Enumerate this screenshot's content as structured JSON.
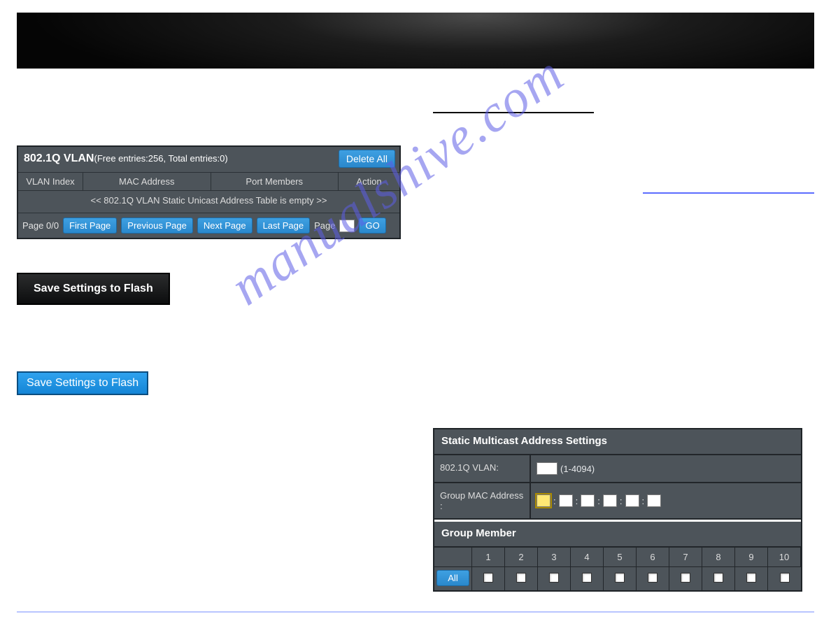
{
  "watermark": "manualshive.com",
  "left": {
    "vlan": {
      "title_bold": "802.1Q VLAN",
      "title_tail": "(Free entries:256, Total entries:0)",
      "delete_all": "Delete All",
      "col_index": "VLAN Index",
      "col_mac": "MAC Address",
      "col_members": "Port Members",
      "col_action": "Action",
      "empty_msg": "<< 802.1Q VLAN Static Unicast Address Table is empty >>",
      "page_of": "Page 0/0",
      "first": "First Page",
      "prev": "Previous Page",
      "next": "Next Page",
      "last": "Last Page",
      "page_label": "Page",
      "go": "GO"
    },
    "save_black": "Save Settings to Flash",
    "save_blue": "Save Settings to Flash"
  },
  "right": {
    "mcast": {
      "settings_title": "Static Multicast Address Settings",
      "vlan_label": "802.1Q VLAN:",
      "vlan_range": "(1-4094)",
      "mac_label": "Group MAC Address :",
      "colon": ":",
      "group_title": "Group Member",
      "ports": [
        "1",
        "2",
        "3",
        "4",
        "5",
        "6",
        "7",
        "8",
        "9",
        "10"
      ],
      "all_btn": "All"
    }
  }
}
